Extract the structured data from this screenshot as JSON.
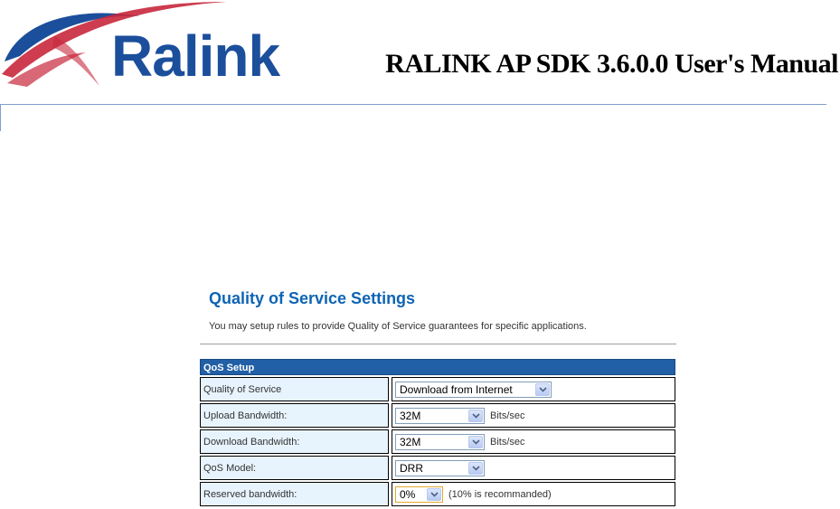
{
  "header": {
    "logo_text": "Ralink",
    "manual_title": "RALINK AP SDK 3.6.0.0 User's Manual"
  },
  "page": {
    "heading": "Quality of Service Settings",
    "description": "You may setup rules to provide Quality of Service guarantees for specific applications."
  },
  "qos_setup": {
    "title": "QoS Setup",
    "rows": [
      {
        "label": "Quality of Service",
        "value": "Download from Internet",
        "unit": ""
      },
      {
        "label": "Upload Bandwidth:",
        "value": "32M",
        "unit": "Bits/sec"
      },
      {
        "label": "Download Bandwidth:",
        "value": "32M",
        "unit": "Bits/sec"
      },
      {
        "label": "QoS Model:",
        "value": "DRR",
        "unit": ""
      },
      {
        "label": "Reserved bandwidth:",
        "value": "0%",
        "unit": "(10% is recommanded)"
      }
    ]
  },
  "colors": {
    "brand_blue": "#1b4f9c",
    "logo_red": "#c8283c",
    "heading_blue": "#0e64b4",
    "table_header": "#215fa6",
    "label_cell_bg": "#e8f4fd"
  },
  "icons": {
    "dropdown": "chevron-down-icon"
  }
}
